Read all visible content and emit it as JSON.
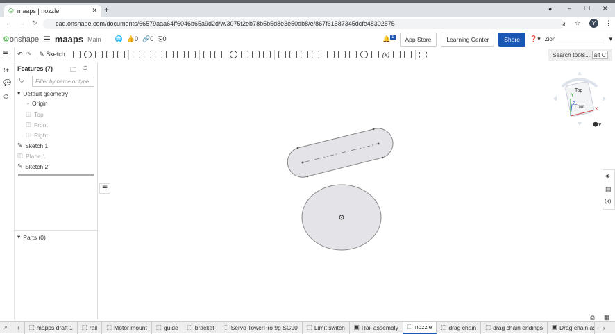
{
  "browser": {
    "tab_title": "maaps | nozzle",
    "url": "cad.onshape.com/documents/66579aaa64ff6046b65a9d2d/w/3075f2eb78b5b5d8e3e50db8/e/867f61587345dcfe48302575",
    "profile": "Y"
  },
  "header": {
    "logo": "onshape",
    "doc_name": "maaps",
    "branch": "Main",
    "likes": "0",
    "links": "0",
    "copies": "0",
    "notif_count": "1",
    "app_store": "App Store",
    "learning_center": "Learning Center",
    "share": "Share",
    "user": "Zion________________"
  },
  "toolbar": {
    "sketch": "Sketch",
    "search": "Search tools...",
    "search_shortcut": "alt C"
  },
  "features": {
    "title": "Features (7)",
    "filter_placeholder": "Filter by name or type",
    "default_geometry": "Default geometry",
    "items": [
      "Origin",
      "Top",
      "Front",
      "Right",
      "Sketch 1",
      "Plane 1",
      "Sketch 2"
    ],
    "parts": "Parts (0)"
  },
  "viewcube": {
    "top": "Top",
    "front": "Front",
    "x": "X",
    "y": "Y",
    "z": "Z"
  },
  "tabs": [
    "mapps draft 1",
    "rail",
    "Motor mount",
    "guide",
    "bracket",
    "Servo TowerPro 9g SG90",
    "Limit switch",
    "Rail assembly",
    "nozzle",
    "drag chain",
    "drag chain endings",
    "Drag chain as"
  ],
  "active_tab": "nozzle"
}
